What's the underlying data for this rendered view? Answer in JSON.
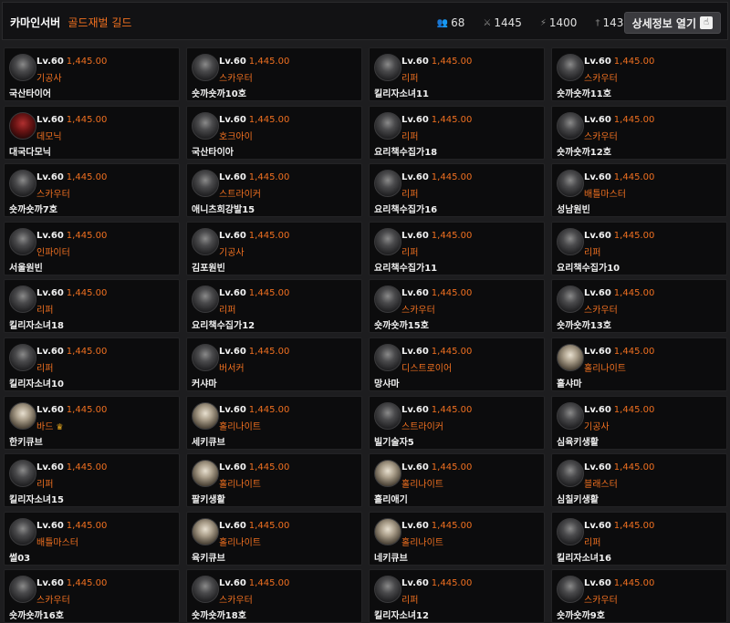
{
  "header": {
    "server": "카마인서버",
    "guild": "골드재벌 길드",
    "stats": [
      {
        "icon": "members-icon",
        "value": "68"
      },
      {
        "icon": "sword-icon",
        "value": "1445"
      },
      {
        "icon": "lightning-icon",
        "value": "1400"
      },
      {
        "icon": "dagger-icon",
        "value": "1431"
      }
    ],
    "detail_button": "상세정보 열기"
  },
  "members": [
    {
      "level": "Lv.60",
      "power": "1,445.00",
      "class": "기공사",
      "name": "국산타이어",
      "avatar": "dark"
    },
    {
      "level": "Lv.60",
      "power": "1,445.00",
      "class": "스카우터",
      "name": "숏까숏까10호",
      "avatar": "dark"
    },
    {
      "level": "Lv.60",
      "power": "1,445.00",
      "class": "리퍼",
      "name": "킬리자소녀11",
      "avatar": "dark"
    },
    {
      "level": "Lv.60",
      "power": "1,445.00",
      "class": "스카우터",
      "name": "숏까숏까11호",
      "avatar": "dark"
    },
    {
      "level": "Lv.60",
      "power": "1,445.00",
      "class": "데모닉",
      "name": "대국다모닉",
      "avatar": "red"
    },
    {
      "level": "Lv.60",
      "power": "1,445.00",
      "class": "호크아이",
      "name": "국산타이아",
      "avatar": "dark"
    },
    {
      "level": "Lv.60",
      "power": "1,445.00",
      "class": "리퍼",
      "name": "요리책수집가18",
      "avatar": "dark"
    },
    {
      "level": "Lv.60",
      "power": "1,445.00",
      "class": "스카우터",
      "name": "숏까숏까12호",
      "avatar": "dark"
    },
    {
      "level": "Lv.60",
      "power": "1,445.00",
      "class": "스카우터",
      "name": "숏까숏까7호",
      "avatar": "dark"
    },
    {
      "level": "Lv.60",
      "power": "1,445.00",
      "class": "스트라이커",
      "name": "애니츠희강발15",
      "avatar": "dark"
    },
    {
      "level": "Lv.60",
      "power": "1,445.00",
      "class": "리퍼",
      "name": "요리책수집가16",
      "avatar": "dark"
    },
    {
      "level": "Lv.60",
      "power": "1,445.00",
      "class": "배틀마스터",
      "name": "성남원빈",
      "avatar": "dark"
    },
    {
      "level": "Lv.60",
      "power": "1,445.00",
      "class": "인파이터",
      "name": "서울원빈",
      "avatar": "dark"
    },
    {
      "level": "Lv.60",
      "power": "1,445.00",
      "class": "기공사",
      "name": "김포원빈",
      "avatar": "dark"
    },
    {
      "level": "Lv.60",
      "power": "1,445.00",
      "class": "리퍼",
      "name": "요리책수집가11",
      "avatar": "dark"
    },
    {
      "level": "Lv.60",
      "power": "1,445.00",
      "class": "리퍼",
      "name": "요리책수집가10",
      "avatar": "dark"
    },
    {
      "level": "Lv.60",
      "power": "1,445.00",
      "class": "리퍼",
      "name": "킬리자소녀18",
      "avatar": "dark"
    },
    {
      "level": "Lv.60",
      "power": "1,445.00",
      "class": "리퍼",
      "name": "요리책수집가12",
      "avatar": "dark"
    },
    {
      "level": "Lv.60",
      "power": "1,445.00",
      "class": "스카우터",
      "name": "숏까숏까15호",
      "avatar": "dark"
    },
    {
      "level": "Lv.60",
      "power": "1,445.00",
      "class": "스카우터",
      "name": "숏까숏까13호",
      "avatar": "dark"
    },
    {
      "level": "Lv.60",
      "power": "1,445.00",
      "class": "리퍼",
      "name": "킬리자소녀10",
      "avatar": "dark"
    },
    {
      "level": "Lv.60",
      "power": "1,445.00",
      "class": "버서커",
      "name": "커샤마",
      "avatar": "dark"
    },
    {
      "level": "Lv.60",
      "power": "1,445.00",
      "class": "디스트로이어",
      "name": "망샤마",
      "avatar": "dark"
    },
    {
      "level": "Lv.60",
      "power": "1,445.00",
      "class": "홀리나이트",
      "name": "홀샤마",
      "avatar": "light"
    },
    {
      "level": "Lv.60",
      "power": "1,445.00",
      "class": "바드",
      "name": "한키큐브",
      "avatar": "light",
      "leader": true
    },
    {
      "level": "Lv.60",
      "power": "1,445.00",
      "class": "홀리나이트",
      "name": "세키큐브",
      "avatar": "light"
    },
    {
      "level": "Lv.60",
      "power": "1,445.00",
      "class": "스트라이커",
      "name": "빌기술자5",
      "avatar": "dark"
    },
    {
      "level": "Lv.60",
      "power": "1,445.00",
      "class": "기공사",
      "name": "심육키생활",
      "avatar": "dark"
    },
    {
      "level": "Lv.60",
      "power": "1,445.00",
      "class": "리퍼",
      "name": "킬리자소녀15",
      "avatar": "dark"
    },
    {
      "level": "Lv.60",
      "power": "1,445.00",
      "class": "홀리나이트",
      "name": "팔키생활",
      "avatar": "light"
    },
    {
      "level": "Lv.60",
      "power": "1,445.00",
      "class": "홀리나이트",
      "name": "홀리애기",
      "avatar": "light"
    },
    {
      "level": "Lv.60",
      "power": "1,445.00",
      "class": "블래스터",
      "name": "심칠키생활",
      "avatar": "dark"
    },
    {
      "level": "Lv.60",
      "power": "1,445.00",
      "class": "배틀마스터",
      "name": "썰03",
      "avatar": "dark"
    },
    {
      "level": "Lv.60",
      "power": "1,445.00",
      "class": "홀리나이트",
      "name": "육키큐브",
      "avatar": "light"
    },
    {
      "level": "Lv.60",
      "power": "1,445.00",
      "class": "홀리나이트",
      "name": "네키큐브",
      "avatar": "light"
    },
    {
      "level": "Lv.60",
      "power": "1,445.00",
      "class": "리퍼",
      "name": "킬리자소녀16",
      "avatar": "dark"
    },
    {
      "level": "Lv.60",
      "power": "1,445.00",
      "class": "스카우터",
      "name": "숏까숏까16호",
      "avatar": "dark"
    },
    {
      "level": "Lv.60",
      "power": "1,445.00",
      "class": "스카우터",
      "name": "숏까숏까18호",
      "avatar": "dark"
    },
    {
      "level": "Lv.60",
      "power": "1,445.00",
      "class": "리퍼",
      "name": "킬리자소녀12",
      "avatar": "dark"
    },
    {
      "level": "Lv.60",
      "power": "1,445.00",
      "class": "스카우터",
      "name": "숏까숏까9호",
      "avatar": "dark"
    }
  ],
  "colors": {
    "accent": "#f07020",
    "background": "#1d1d1f",
    "card": "#0c0c0d",
    "crown": "#f2b01e"
  }
}
